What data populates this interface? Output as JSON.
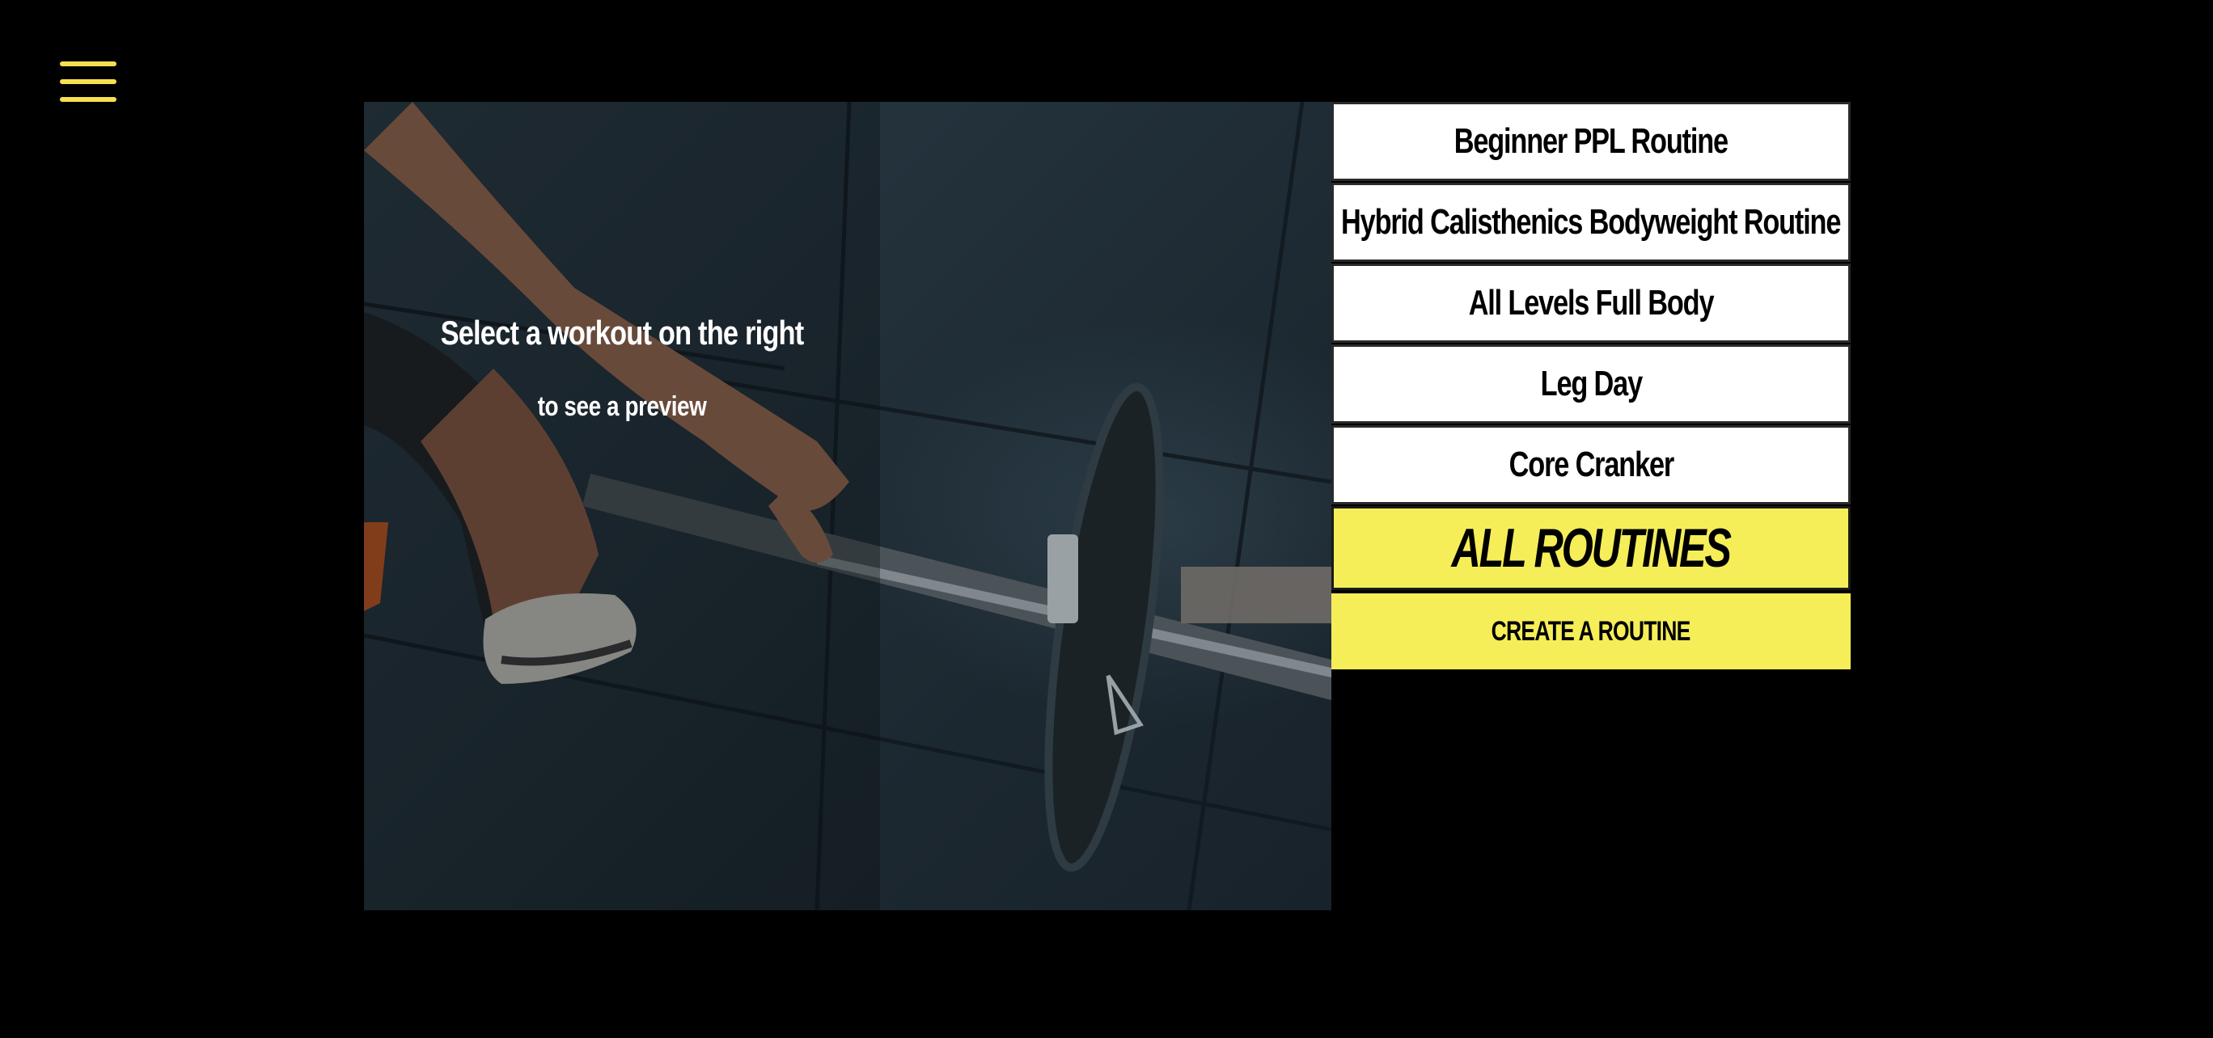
{
  "menu": {
    "icon": "hamburger-menu-icon",
    "color": "#f5e04f"
  },
  "hero": {
    "title": "Select a workout on the right",
    "subtitle": "to see a preview"
  },
  "routines": [
    {
      "label": "Beginner PPL Routine"
    },
    {
      "label": "Hybrid Calisthenics Bodyweight Routine"
    },
    {
      "label": "All Levels Full Body"
    },
    {
      "label": "Leg Day"
    },
    {
      "label": "Core Cranker"
    }
  ],
  "actions": {
    "all_routines": "ALL ROUTINES",
    "create_routine": "CREATE A ROUTINE"
  },
  "colors": {
    "background": "#000000",
    "accent_yellow": "#f5ee58",
    "item_background": "#ffffff"
  }
}
